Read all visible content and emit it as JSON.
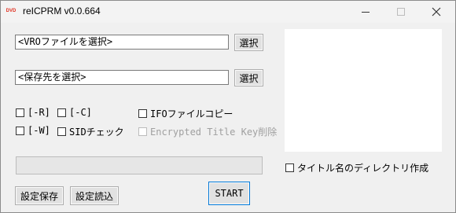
{
  "window": {
    "title": "reICPRM v0.0.664",
    "app_icon_text": "DVD",
    "close_glyph": "✕"
  },
  "vro_file": {
    "value": "<VROファイルを選択>",
    "select_label": "選択"
  },
  "destination": {
    "value": "<保存先を選択>",
    "select_label": "選択"
  },
  "options": {
    "r": {
      "label": "[-R]",
      "checked": false
    },
    "c": {
      "label": "[-C]",
      "checked": false
    },
    "ifo_copy": {
      "label": "IFOファイルコピー",
      "checked": false
    },
    "w": {
      "label": "[-W]",
      "checked": false
    },
    "sid_check": {
      "label": "SIDチェック",
      "checked": false
    },
    "encrypted_title_key_delete": {
      "label": "Encrypted Title Key削除",
      "checked": false,
      "enabled": false
    },
    "title_dir": {
      "label": "タイトル名のディレクトリ作成",
      "checked": false
    }
  },
  "progress": {
    "fraction": 0
  },
  "buttons": {
    "save_settings": "設定保存",
    "load_settings": "設定読込",
    "start": "START"
  },
  "colors": {
    "progress_fill": "#06b025",
    "preview_bg": "#ffffff"
  }
}
